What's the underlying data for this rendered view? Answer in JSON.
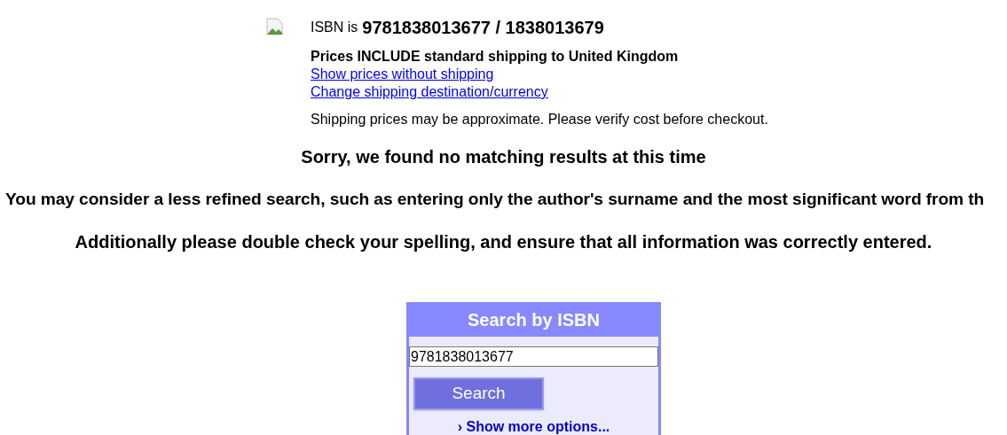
{
  "isbn": {
    "label": "ISBN is",
    "value": "9781838013677 / 1838013679"
  },
  "shipping": {
    "notice": "Prices INCLUDE standard shipping to United Kingdom",
    "links": [
      "Show prices without shipping",
      "Change shipping destination/currency"
    ],
    "note": "Shipping prices may be approximate. Please verify cost before checkout."
  },
  "messages": [
    "Sorry, we found no matching results at this time",
    "You may consider a less refined search, such as entering only the author's surname and the most significant word from th",
    "Additionally please double check your spelling, and ensure that all information was correctly entered."
  ],
  "search_box": {
    "title": "Search by ISBN",
    "value": "9781838013677",
    "button": "Search",
    "more_marker": "›",
    "more": "Show more options..."
  }
}
